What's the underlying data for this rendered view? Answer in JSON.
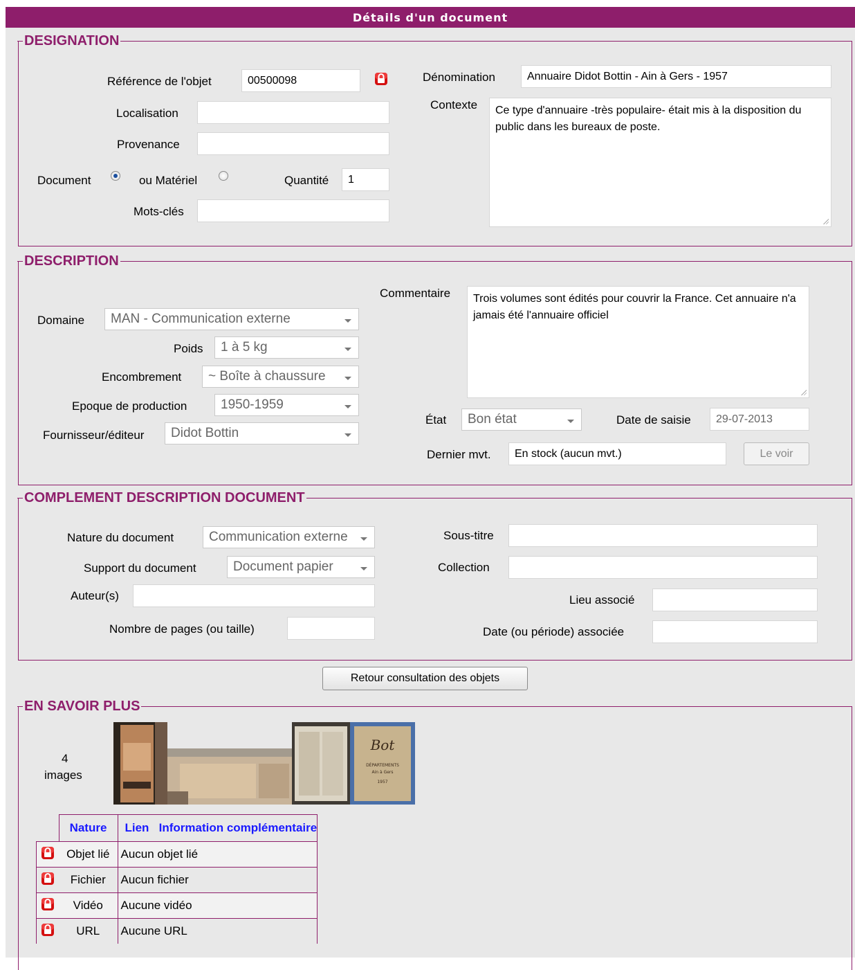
{
  "title": "Détails d'un document",
  "colors": {
    "accent": "#8e1e6b",
    "background": "#e8e8e8",
    "link_header": "#1a1aff"
  },
  "designation": {
    "legend": "DESIGNATION",
    "reference_label": "Référence de l'objet",
    "reference_value": "00500098",
    "localisation_label": "Localisation",
    "localisation_value": "",
    "provenance_label": "Provenance",
    "provenance_value": "",
    "document_label": "Document",
    "materiel_label": "ou Matériel",
    "type_selected": "Document",
    "quantite_label": "Quantité",
    "quantite_value": "1",
    "motscles_label": "Mots-clés",
    "motscles_value": "",
    "denomination_label": "Dénomination",
    "denomination_value": "Annuaire Didot Bottin - Ain à Gers - 1957",
    "contexte_label": "Contexte",
    "contexte_value": "Ce type d'annuaire -très populaire- était mis à la disposition du public dans les bureaux de poste."
  },
  "description": {
    "legend": "DESCRIPTION",
    "domaine_label": "Domaine",
    "domaine_value": "MAN - Communication externe",
    "poids_label": "Poids",
    "poids_value": "1 à 5 kg",
    "encombrement_label": "Encombrement",
    "encombrement_value": "~ Boîte à chaussure",
    "epoque_label": "Epoque de production",
    "epoque_value": "1950-1959",
    "fournisseur_label": "Fournisseur/éditeur",
    "fournisseur_value": "Didot Bottin",
    "commentaire_label": "Commentaire",
    "commentaire_value": "Trois volumes sont édités pour couvrir la France. Cet annuaire n'a jamais été l'annuaire officiel",
    "etat_label": "État",
    "etat_value": "Bon état",
    "date_saisie_label": "Date de saisie",
    "date_saisie_value": "29-07-2013",
    "dernier_mvt_label": "Dernier mvt.",
    "dernier_mvt_value": "En stock (aucun mvt.)",
    "le_voir_label": "Le voir"
  },
  "complement": {
    "legend": "COMPLEMENT DESCRIPTION DOCUMENT",
    "nature_label": "Nature du document",
    "nature_value": "Communication externe",
    "support_label": "Support du document",
    "support_value": "Document papier",
    "auteurs_label": "Auteur(s)",
    "auteurs_value": "",
    "pages_label": "Nombre de pages (ou taille)",
    "pages_value": "",
    "soustitre_label": "Sous-titre",
    "soustitre_value": "",
    "collection_label": "Collection",
    "collection_value": "",
    "lieu_label": "Lieu associé",
    "lieu_value": "",
    "date_assoc_label": "Date (ou période) associée",
    "date_assoc_value": ""
  },
  "retour_button": "Retour consultation des objets",
  "en_savoir_plus": {
    "legend": "EN SAVOIR PLUS",
    "image_count": "4",
    "images_label": "images",
    "headers": {
      "nature": "Nature",
      "lien": "Lien",
      "info": "Information complémentaire"
    },
    "rows": [
      {
        "nature": "Objet lié",
        "lien": "Aucun objet lié",
        "icon": "lock-icon"
      },
      {
        "nature": "Fichier",
        "lien": "Aucun fichier",
        "icon": "lock-icon"
      },
      {
        "nature": "Vidéo",
        "lien": "Aucune vidéo",
        "icon": "lock-icon"
      },
      {
        "nature": "URL",
        "lien": "Aucune URL",
        "icon": "lock-icon"
      }
    ]
  },
  "thumb_texts": {
    "book_label": "DÉPARTEMENTS",
    "book_sub": "Ain à Gers",
    "book_year": "1957"
  }
}
